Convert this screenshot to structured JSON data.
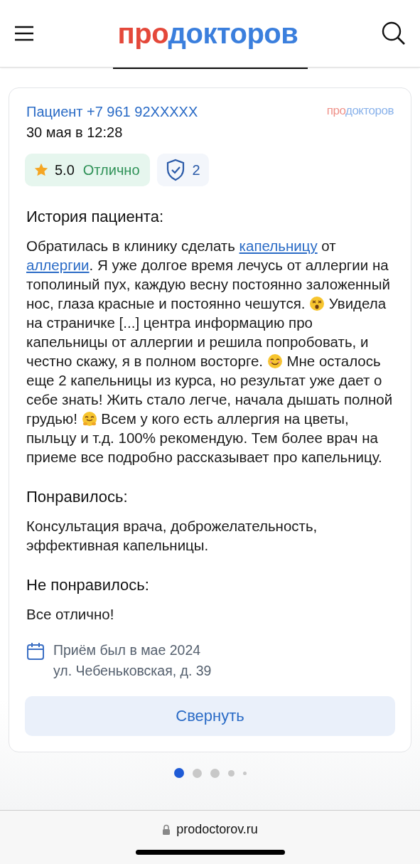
{
  "header": {
    "logo": {
      "prefix": "про",
      "suffix": "докторов"
    }
  },
  "review": {
    "author": "Пациент +7 961 92XXXXX",
    "date": "30 мая в 12:28",
    "source_logo": {
      "prefix": "про",
      "suffix": "докторов"
    },
    "rating": {
      "score": "5.0",
      "verdict": "Отлично"
    },
    "verified_count": "2",
    "sections": [
      {
        "title": "История пациента:",
        "segments": [
          {
            "kind": "text",
            "text": "Обратилась в клинику сделать "
          },
          {
            "kind": "link",
            "text": "капельницу"
          },
          {
            "kind": "text",
            "text": " от "
          },
          {
            "kind": "link",
            "text": "аллергии"
          },
          {
            "kind": "text",
            "text": ". Я уже долгое время лечусь от аллергии на тополиный пух, каждую весну постоянно заложенный нос, глаза красные и постоянно чешутся. "
          },
          {
            "kind": "emoji_dizzy"
          },
          {
            "kind": "text",
            "text": " Увидела на страничке [...] центра информацию про капельницы от аллергии и решила попробовать, и честно скажу, я в полном восторге. "
          },
          {
            "kind": "emoji_smile"
          },
          {
            "kind": "text",
            "text": " Мне осталось еще 2 капельницы из курса, но результат уже дает о себе знать! Жить стало легче, начала дышать полной грудью! "
          },
          {
            "kind": "emoji_hug"
          },
          {
            "kind": "text",
            "text": " Всем у кого есть аллергия на цветы, пыльцу и т.д. 100% рекомендую. Тем более врач на приеме все подробно рассказывает про капельницу."
          }
        ]
      },
      {
        "title": "Понравилось:",
        "segments": [
          {
            "kind": "text",
            "text": "Консультация врача, доброжелательность, эффективная капельницы."
          }
        ]
      },
      {
        "title": "Не понравилось:",
        "segments": [
          {
            "kind": "text",
            "text": "Все отлично!"
          }
        ]
      }
    ],
    "visit": {
      "when": "Приём был в мае 2024",
      "address": "ул. Чебеньковская, д. 39"
    },
    "collapse_button": "Свернуть"
  },
  "pagination": [
    {
      "selected": true
    },
    {
      "selected": false
    },
    {
      "selected": false
    },
    {
      "selected": false
    },
    {
      "selected": false
    }
  ],
  "browser_bar": {
    "url": "prodoctorov.ru"
  }
}
